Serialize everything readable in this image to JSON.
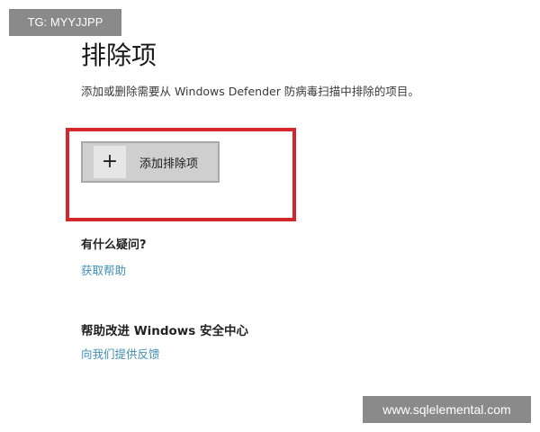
{
  "watermark_top_left": "TG: MYYJJPP",
  "page": {
    "title": "排除项",
    "description": "添加或删除需要从 Windows Defender 防病毒扫描中排除的项目。"
  },
  "add_exclusion": {
    "icon": "plus-icon",
    "icon_glyph": "+",
    "label": "添加排除项",
    "highlight_color": "#d3262d"
  },
  "help": {
    "heading": "有什么疑问?",
    "link_label": "获取帮助"
  },
  "improve": {
    "heading": "帮助改进 Windows 安全中心",
    "link_label": "向我们提供反馈"
  },
  "watermark_bottom_right": "www.sqlelemental.com",
  "colors": {
    "link": "#3f8fb5",
    "button_bg": "#cfcfcf",
    "watermark_bg": "#8a8a8a"
  }
}
